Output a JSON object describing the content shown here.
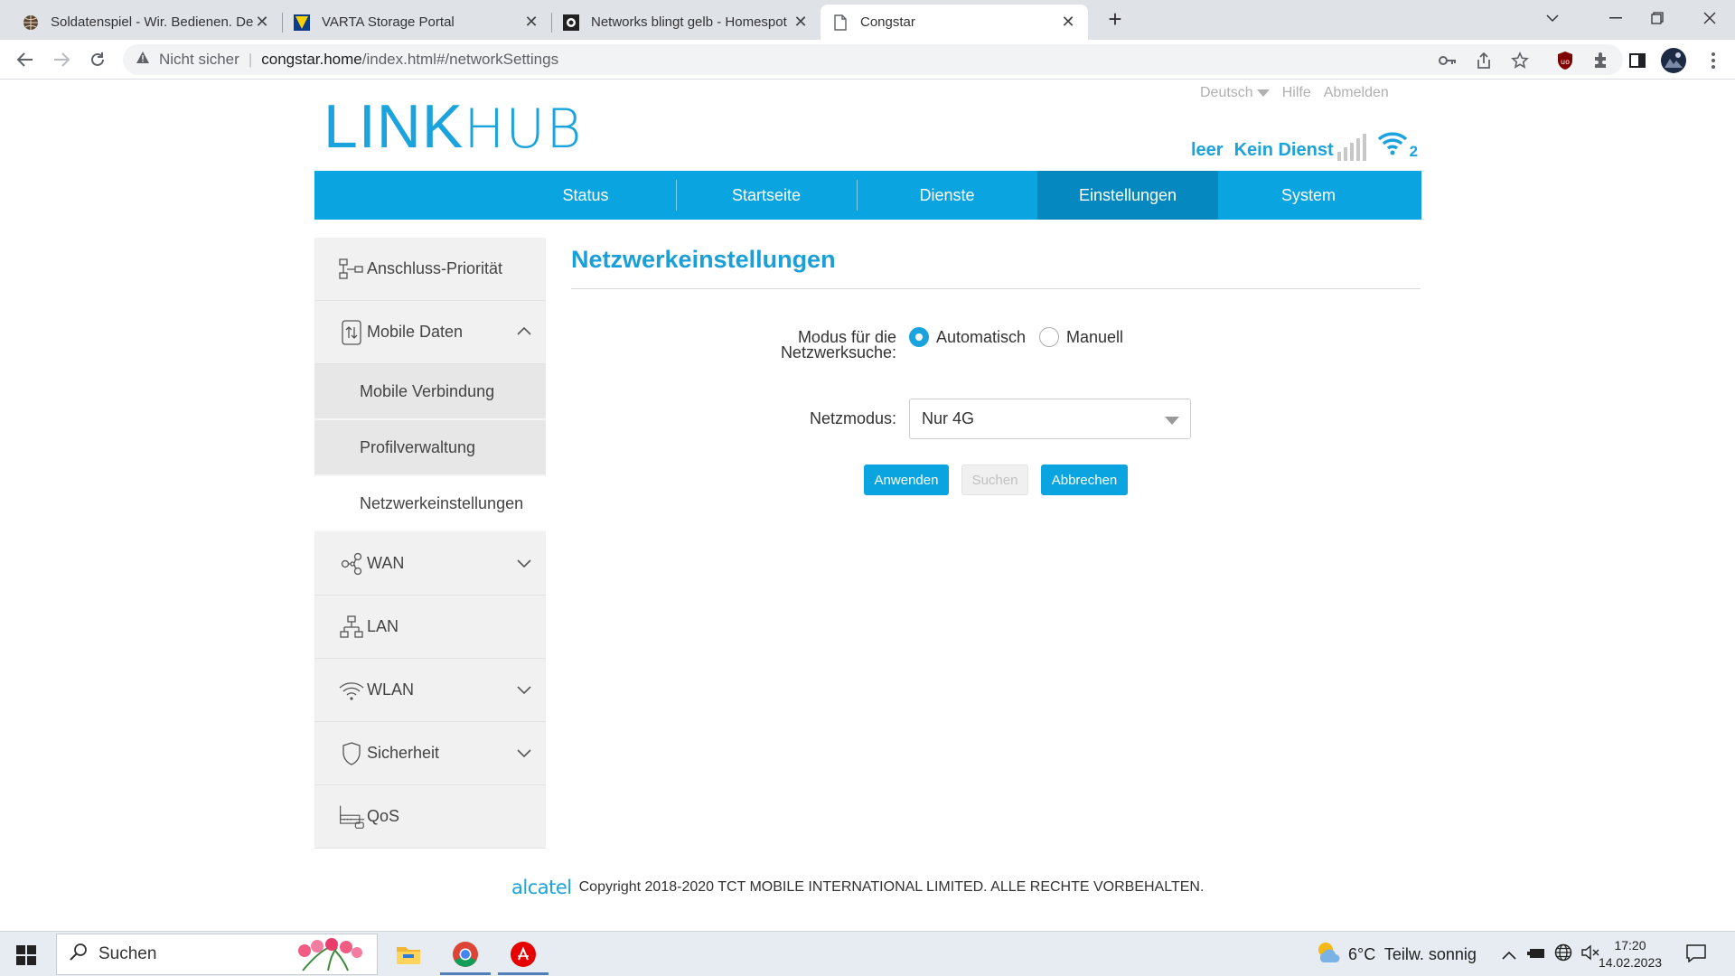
{
  "browser": {
    "tabs": [
      {
        "title": "Soldatenspiel - Wir. Bedienen. Deutschland",
        "icon": "globe-icon"
      },
      {
        "title": "VARTA Storage Portal",
        "icon": "varta-icon"
      },
      {
        "title": "Networks blingt gelb - Homespot",
        "icon": "forum-icon"
      },
      {
        "title": "Congstar",
        "icon": "page-icon"
      }
    ],
    "address": {
      "security": "Nicht sicher",
      "host": "congstar.home",
      "path": "/index.html#/networkSettings"
    }
  },
  "router": {
    "logo_bold": "LINK",
    "logo_light": "HUB",
    "language": "Deutsch",
    "help": "Hilfe",
    "logout": "Abmelden",
    "battery_status": "leer",
    "network_status": "Kein Dienst",
    "wifi_clients": "2",
    "nav": [
      "Status",
      "Startseite",
      "Dienste",
      "Einstellungen",
      "System"
    ],
    "nav_active": "Einstellungen",
    "sidebar": {
      "connection_priority": "Anschluss-Priorität",
      "mobile_data": "Mobile Daten",
      "mobile_connection": "Mobile Verbindung",
      "profile_management": "Profilverwaltung",
      "network_settings": "Netzwerkeinstellungen",
      "wan": "WAN",
      "lan": "LAN",
      "wlan": "WLAN",
      "security": "Sicherheit",
      "qos": "QoS"
    },
    "content": {
      "title": "Netzwerkeinstellungen",
      "search_mode_label_1": "Modus für die",
      "search_mode_label_2": "Netzwerksuche:",
      "mode_auto": "Automatisch",
      "mode_manual": "Manuell",
      "mode_selected": "Automatisch",
      "netmode_label": "Netzmodus:",
      "netmode_value": "Nur 4G",
      "btn_apply": "Anwenden",
      "btn_search": "Suchen",
      "btn_cancel": "Abbrechen"
    },
    "footer": {
      "brand": "alcatel",
      "copyright": "Copyright 2018-2020 TCT MOBILE INTERNATIONAL LIMITED. ALLE RECHTE VORBEHALTEN."
    },
    "accent_color": "#0aa5e0"
  },
  "taskbar": {
    "search_placeholder": "Suchen",
    "weather": "6°C  Teilw. sonnig",
    "time": "17:20",
    "date": "14.02.2023"
  }
}
